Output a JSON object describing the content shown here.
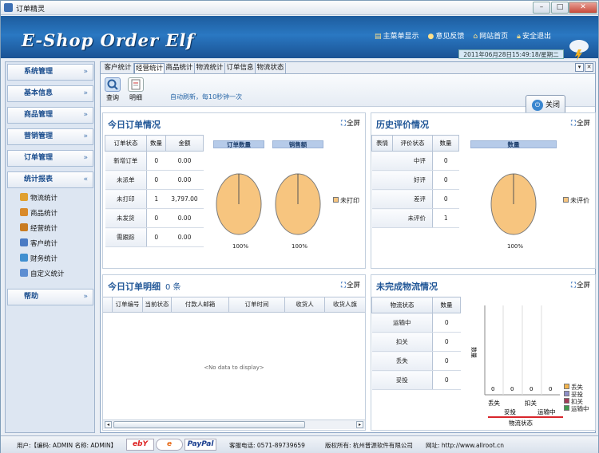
{
  "window": {
    "title": "订单精灵",
    "min_label": "–",
    "max_label": "□",
    "close_label": "✕"
  },
  "banner": {
    "logo": "E-Shop Order Elf",
    "links": [
      "主菜单显示",
      "意见反馈",
      "网站首页",
      "安全退出"
    ],
    "datetime": "2011年06月28日15:49:18/星期二"
  },
  "sidebar": {
    "groups": [
      "系统管理",
      "基本信息",
      "商品管理",
      "营销管理",
      "订单管理",
      "统计报表",
      "帮助"
    ],
    "report_items": [
      "物流统计",
      "商品统计",
      "经营统计",
      "客户统计",
      "财务统计",
      "自定义统计"
    ]
  },
  "tabs": [
    "客户统计",
    "经营统计",
    "商品统计",
    "物流统计",
    "订单信息",
    "物流状态"
  ],
  "active_tab": "经营统计",
  "toolbar": {
    "query": "查询",
    "detail": "明细",
    "auto_refresh": "自动刷新，每10秒钟一次",
    "close": "关闭"
  },
  "full_label": "全屏",
  "today_orders": {
    "title": "今日订单情况",
    "headers": [
      "订单状态",
      "数量",
      "金额"
    ],
    "rows": [
      [
        "新增订单",
        "0",
        "0.00"
      ],
      [
        "未派单",
        "0",
        "0.00"
      ],
      [
        "未打印",
        "1",
        "3,797.00"
      ],
      [
        "未发货",
        "0",
        "0.00"
      ],
      [
        "需跟踪",
        "0",
        "0.00"
      ]
    ],
    "chart_bars": [
      "订单数量",
      "销售额"
    ],
    "pie_labels": [
      "100%",
      "100%"
    ],
    "legend": "未打印"
  },
  "history_reviews": {
    "title": "历史评价情况",
    "headers": [
      "表情",
      "评价状态",
      "数量"
    ],
    "rows": [
      [
        "中评",
        "0"
      ],
      [
        "好评",
        "0"
      ],
      [
        "差评",
        "0"
      ],
      [
        "未评价",
        "1"
      ]
    ],
    "chart_bar": "数量",
    "pie_label": "100%",
    "legend": "未评价"
  },
  "order_details": {
    "title": "今日订单明细",
    "count": "0 条",
    "headers": [
      "订单编号",
      "当前状态",
      "付款人邮箱",
      "订单时间",
      "收货人",
      "收货人旗"
    ],
    "empty": "<No data to display>"
  },
  "logistics": {
    "title": "未完成物流情况",
    "headers": [
      "物流状态",
      "数量"
    ],
    "rows": [
      [
        "运输中",
        "0"
      ],
      [
        "扣关",
        "0"
      ],
      [
        "丢失",
        "0"
      ],
      [
        "妥投",
        "0"
      ]
    ],
    "y_label": "数量",
    "x_label": "物流状态",
    "x_ticks_top": [
      "丢失",
      "扣关"
    ],
    "x_ticks_bottom": [
      "妥投",
      "运输中"
    ],
    "bar_values": [
      "0",
      "0",
      "0",
      "0"
    ],
    "legend": [
      "丢失",
      "妥投",
      "扣关",
      "运输中"
    ],
    "legend_colors": [
      "#f4b54e",
      "#8d8fc8",
      "#a33b57",
      "#3d9a4c"
    ]
  },
  "status": {
    "user": "用户:【编码: ADMIN  名称: ADMIN】",
    "pay_logos": [
      "ebY",
      "e",
      "PayPal"
    ],
    "phone": "客服电话: 0571-89739659",
    "copyright": "版权所有: 杭州普源软件有限公司",
    "website": "网址: http://www.allroot.cn"
  },
  "chart_data": [
    {
      "type": "pie",
      "title": "订单数量",
      "labels": [
        "未打印"
      ],
      "values": [
        100
      ],
      "pct_labels": [
        "100%"
      ]
    },
    {
      "type": "pie",
      "title": "销售额",
      "labels": [
        "未打印"
      ],
      "values": [
        100
      ],
      "pct_labels": [
        "100%"
      ]
    },
    {
      "type": "pie",
      "title": "数量",
      "labels": [
        "未评价"
      ],
      "values": [
        100
      ],
      "pct_labels": [
        "100%"
      ]
    },
    {
      "type": "bar",
      "categories": [
        "丢失",
        "妥投",
        "扣关",
        "运输中"
      ],
      "values": [
        0,
        0,
        0,
        0
      ],
      "xlabel": "物流状态",
      "ylabel": "数量"
    }
  ]
}
